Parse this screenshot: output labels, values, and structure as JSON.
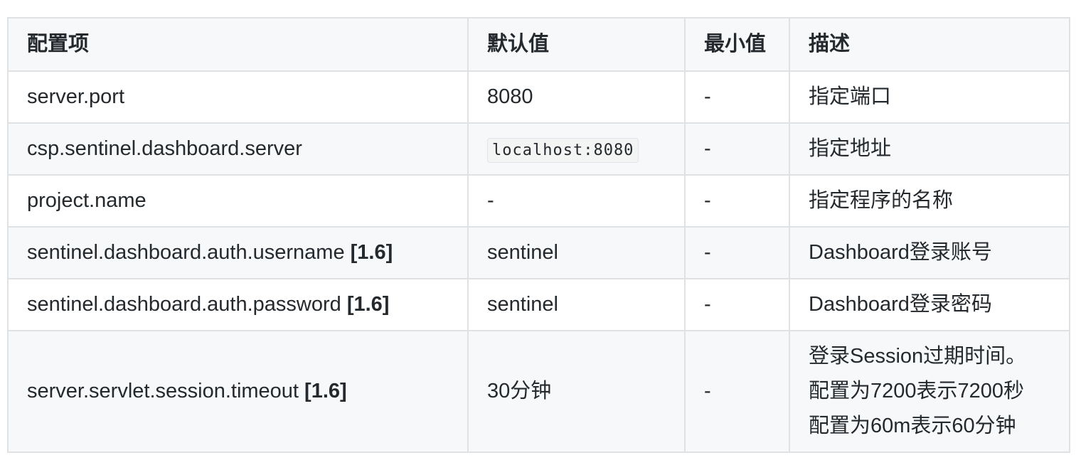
{
  "table": {
    "headers": [
      "配置项",
      "默认值",
      "最小值",
      "描述"
    ],
    "rows": [
      {
        "key": "server.port",
        "tag": "",
        "default": "8080",
        "default_is_code": false,
        "min": "-",
        "desc": [
          "指定端口"
        ]
      },
      {
        "key": "csp.sentinel.dashboard.server",
        "tag": "",
        "default": "localhost:8080",
        "default_is_code": true,
        "min": "-",
        "desc": [
          "指定地址"
        ]
      },
      {
        "key": "project.name",
        "tag": "",
        "default": "-",
        "default_is_code": false,
        "min": "-",
        "desc": [
          "指定程序的名称"
        ]
      },
      {
        "key": "sentinel.dashboard.auth.username ",
        "tag": "[1.6]",
        "default": "sentinel",
        "default_is_code": false,
        "min": "-",
        "desc": [
          "Dashboard登录账号"
        ]
      },
      {
        "key": "sentinel.dashboard.auth.password ",
        "tag": "[1.6]",
        "default": "sentinel",
        "default_is_code": false,
        "min": "-",
        "desc": [
          "Dashboard登录密码"
        ]
      },
      {
        "key": "server.servlet.session.timeout ",
        "tag": "[1.6]",
        "default": "30分钟",
        "default_is_code": false,
        "min": "-",
        "desc": [
          "登录Session过期时间。",
          "配置为7200表示7200秒",
          "配置为60m表示60分钟"
        ]
      }
    ]
  }
}
